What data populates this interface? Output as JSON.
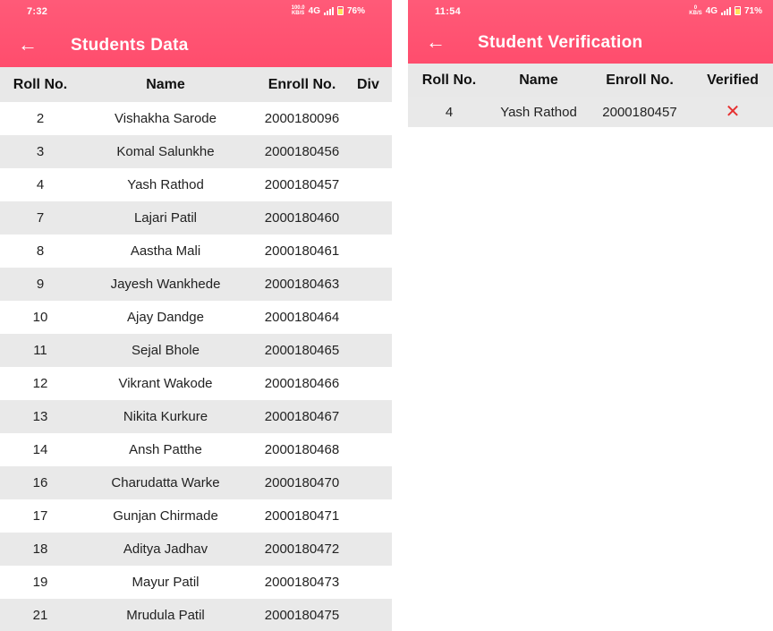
{
  "left": {
    "status": {
      "time": "7:32",
      "network_top": "100.0",
      "network_bottom": "KB/S",
      "net_type": "4G",
      "battery": "76%"
    },
    "title": "Students Data",
    "columns": [
      "Roll No.",
      "Name",
      "Enroll No.",
      "Div"
    ],
    "rows": [
      {
        "roll": "2",
        "name": "Vishakha Sarode",
        "enroll": "2000180096"
      },
      {
        "roll": "3",
        "name": "Komal Salunkhe",
        "enroll": "2000180456"
      },
      {
        "roll": "4",
        "name": "Yash Rathod",
        "enroll": "2000180457"
      },
      {
        "roll": "7",
        "name": "Lajari Patil",
        "enroll": "2000180460"
      },
      {
        "roll": "8",
        "name": "Aastha Mali",
        "enroll": "2000180461"
      },
      {
        "roll": "9",
        "name": "Jayesh Wankhede",
        "enroll": "2000180463"
      },
      {
        "roll": "10",
        "name": "Ajay Dandge",
        "enroll": "2000180464"
      },
      {
        "roll": "11",
        "name": "Sejal Bhole",
        "enroll": "2000180465"
      },
      {
        "roll": "12",
        "name": "Vikrant Wakode",
        "enroll": "2000180466"
      },
      {
        "roll": "13",
        "name": "Nikita Kurkure",
        "enroll": "2000180467"
      },
      {
        "roll": "14",
        "name": "Ansh Patthe",
        "enroll": "2000180468"
      },
      {
        "roll": "16",
        "name": "Charudatta Warke",
        "enroll": "2000180470"
      },
      {
        "roll": "17",
        "name": "Gunjan Chirmade",
        "enroll": "2000180471"
      },
      {
        "roll": "18",
        "name": "Aditya Jadhav",
        "enroll": "2000180472"
      },
      {
        "roll": "19",
        "name": "Mayur Patil",
        "enroll": "2000180473"
      },
      {
        "roll": "21",
        "name": "Mrudula Patil",
        "enroll": "2000180475"
      }
    ]
  },
  "right": {
    "status": {
      "time": "11:54",
      "network_top": "0",
      "network_bottom": "KB/S",
      "net_type": "4G",
      "battery": "71%"
    },
    "title": "Student Verification",
    "columns": [
      "Roll No.",
      "Name",
      "Enroll No.",
      "Verified"
    ],
    "rows": [
      {
        "roll": "4",
        "name": "Yash Rathod",
        "enroll": "2000180457",
        "verified_icon": "cross-icon"
      }
    ]
  },
  "colors": {
    "appbar": "#ff4d6d",
    "header_bg": "#e8e8e8",
    "stripe": "#e9e9e9",
    "cross": "#e63030"
  }
}
